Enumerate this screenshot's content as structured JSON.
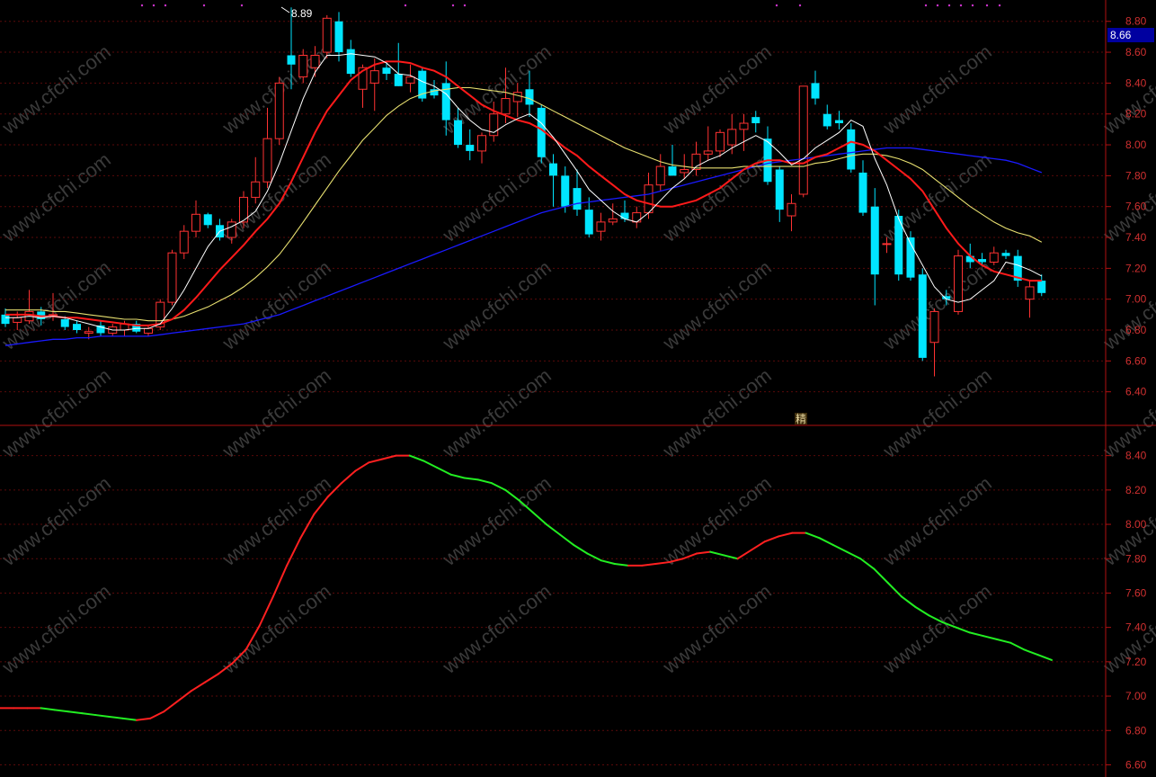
{
  "watermark": "www.cfchi.com",
  "price_tag": "8.66",
  "high_label": "8.89",
  "mid_marker": "精",
  "colors": {
    "background": "#000000",
    "up": "#ff3232",
    "down": "#00e5ff",
    "ma5": "#ffffff",
    "ma10": "#ff1a1a",
    "ma20": "#e8e070",
    "ma60": "#1a1aff",
    "axis": "#b01010",
    "grid": "#5a0a0a",
    "price_tag_bg": "#0000a0",
    "indicator_up": "#ff2020",
    "indicator_down": "#22ee22",
    "signal_dot": "#cc33cc"
  },
  "chart_data": [
    {
      "type": "candlestick",
      "ylim": [
        6.2,
        8.88
      ],
      "y_ticks": [
        "8.80",
        "8.60",
        "8.40",
        "8.20",
        "8.00",
        "7.80",
        "7.60",
        "7.40",
        "7.20",
        "7.00",
        "6.80",
        "6.60",
        "6.40"
      ],
      "grid": true,
      "candles": [
        {
          "o": 6.9,
          "h": 6.94,
          "l": 6.82,
          "c": 6.84
        },
        {
          "o": 6.85,
          "h": 6.92,
          "l": 6.8,
          "c": 6.88
        },
        {
          "o": 6.86,
          "h": 7.06,
          "l": 6.84,
          "c": 6.92
        },
        {
          "o": 6.92,
          "h": 6.95,
          "l": 6.83,
          "c": 6.87
        },
        {
          "o": 6.9,
          "h": 7.04,
          "l": 6.86,
          "c": 6.9
        },
        {
          "o": 6.87,
          "h": 6.89,
          "l": 6.8,
          "c": 6.82
        },
        {
          "o": 6.84,
          "h": 6.86,
          "l": 6.78,
          "c": 6.8
        },
        {
          "o": 6.78,
          "h": 6.82,
          "l": 6.74,
          "c": 6.79
        },
        {
          "o": 6.83,
          "h": 6.86,
          "l": 6.76,
          "c": 6.78
        },
        {
          "o": 6.78,
          "h": 6.84,
          "l": 6.76,
          "c": 6.82
        },
        {
          "o": 6.8,
          "h": 6.86,
          "l": 6.76,
          "c": 6.84
        },
        {
          "o": 6.84,
          "h": 6.86,
          "l": 6.78,
          "c": 6.79
        },
        {
          "o": 6.78,
          "h": 6.83,
          "l": 6.76,
          "c": 6.81
        },
        {
          "o": 6.82,
          "h": 7.0,
          "l": 6.8,
          "c": 6.98
        },
        {
          "o": 6.98,
          "h": 7.32,
          "l": 6.96,
          "c": 7.3
        },
        {
          "o": 7.3,
          "h": 7.48,
          "l": 7.26,
          "c": 7.44
        },
        {
          "o": 7.44,
          "h": 7.64,
          "l": 7.4,
          "c": 7.55
        },
        {
          "o": 7.55,
          "h": 7.56,
          "l": 7.46,
          "c": 7.48
        },
        {
          "o": 7.48,
          "h": 7.52,
          "l": 7.38,
          "c": 7.4
        },
        {
          "o": 7.4,
          "h": 7.52,
          "l": 7.36,
          "c": 7.5
        },
        {
          "o": 7.5,
          "h": 7.7,
          "l": 7.46,
          "c": 7.66
        },
        {
          "o": 7.66,
          "h": 7.92,
          "l": 7.62,
          "c": 7.76
        },
        {
          "o": 7.76,
          "h": 8.24,
          "l": 7.72,
          "c": 8.04
        },
        {
          "o": 8.04,
          "h": 8.44,
          "l": 8.0,
          "c": 8.4
        },
        {
          "o": 8.58,
          "h": 8.89,
          "l": 8.36,
          "c": 8.52
        },
        {
          "o": 8.44,
          "h": 8.62,
          "l": 8.4,
          "c": 8.58
        },
        {
          "o": 8.5,
          "h": 8.64,
          "l": 8.44,
          "c": 8.58
        },
        {
          "o": 8.6,
          "h": 8.84,
          "l": 8.56,
          "c": 8.82
        },
        {
          "o": 8.8,
          "h": 8.86,
          "l": 8.54,
          "c": 8.6
        },
        {
          "o": 8.62,
          "h": 8.68,
          "l": 8.44,
          "c": 8.46
        },
        {
          "o": 8.36,
          "h": 8.52,
          "l": 8.24,
          "c": 8.5
        },
        {
          "o": 8.4,
          "h": 8.56,
          "l": 8.22,
          "c": 8.48
        },
        {
          "o": 8.5,
          "h": 8.54,
          "l": 8.42,
          "c": 8.46
        },
        {
          "o": 8.46,
          "h": 8.66,
          "l": 8.38,
          "c": 8.38
        },
        {
          "o": 8.4,
          "h": 8.52,
          "l": 8.34,
          "c": 8.44
        },
        {
          "o": 8.48,
          "h": 8.5,
          "l": 8.28,
          "c": 8.3
        },
        {
          "o": 8.36,
          "h": 8.42,
          "l": 8.3,
          "c": 8.32
        },
        {
          "o": 8.4,
          "h": 8.54,
          "l": 8.06,
          "c": 8.16
        },
        {
          "o": 8.16,
          "h": 8.24,
          "l": 7.98,
          "c": 8.0
        },
        {
          "o": 8.0,
          "h": 8.1,
          "l": 7.9,
          "c": 7.96
        },
        {
          "o": 7.96,
          "h": 8.08,
          "l": 7.88,
          "c": 8.06
        },
        {
          "o": 8.06,
          "h": 8.28,
          "l": 8.02,
          "c": 8.2
        },
        {
          "o": 8.2,
          "h": 8.5,
          "l": 8.14,
          "c": 8.3
        },
        {
          "o": 8.28,
          "h": 8.4,
          "l": 8.18,
          "c": 8.34
        },
        {
          "o": 8.36,
          "h": 8.48,
          "l": 8.18,
          "c": 8.26
        },
        {
          "o": 8.24,
          "h": 8.26,
          "l": 7.88,
          "c": 7.92
        },
        {
          "o": 7.88,
          "h": 7.94,
          "l": 7.6,
          "c": 7.8
        },
        {
          "o": 7.8,
          "h": 7.86,
          "l": 7.56,
          "c": 7.6
        },
        {
          "o": 7.72,
          "h": 7.84,
          "l": 7.54,
          "c": 7.58
        },
        {
          "o": 7.58,
          "h": 7.66,
          "l": 7.4,
          "c": 7.42
        },
        {
          "o": 7.44,
          "h": 7.56,
          "l": 7.38,
          "c": 7.5
        },
        {
          "o": 7.5,
          "h": 7.62,
          "l": 7.48,
          "c": 7.52
        },
        {
          "o": 7.56,
          "h": 7.64,
          "l": 7.5,
          "c": 7.52
        },
        {
          "o": 7.5,
          "h": 7.6,
          "l": 7.46,
          "c": 7.56
        },
        {
          "o": 7.56,
          "h": 7.82,
          "l": 7.52,
          "c": 7.74
        },
        {
          "o": 7.74,
          "h": 7.94,
          "l": 7.7,
          "c": 7.86
        },
        {
          "o": 7.86,
          "h": 8.0,
          "l": 7.8,
          "c": 7.8
        },
        {
          "o": 7.82,
          "h": 7.94,
          "l": 7.78,
          "c": 7.84
        },
        {
          "o": 7.84,
          "h": 8.02,
          "l": 7.8,
          "c": 7.94
        },
        {
          "o": 7.94,
          "h": 8.12,
          "l": 7.9,
          "c": 7.96
        },
        {
          "o": 7.96,
          "h": 8.1,
          "l": 7.92,
          "c": 8.08
        },
        {
          "o": 8.0,
          "h": 8.2,
          "l": 7.94,
          "c": 8.1
        },
        {
          "o": 8.1,
          "h": 8.2,
          "l": 7.96,
          "c": 8.14
        },
        {
          "o": 8.18,
          "h": 8.22,
          "l": 8.08,
          "c": 8.14
        },
        {
          "o": 8.04,
          "h": 8.12,
          "l": 7.74,
          "c": 7.76
        },
        {
          "o": 7.84,
          "h": 7.86,
          "l": 7.5,
          "c": 7.58
        },
        {
          "o": 7.54,
          "h": 7.68,
          "l": 7.44,
          "c": 7.62
        },
        {
          "o": 7.68,
          "h": 8.38,
          "l": 7.66,
          "c": 8.38
        },
        {
          "o": 8.4,
          "h": 8.48,
          "l": 8.26,
          "c": 8.3
        },
        {
          "o": 8.2,
          "h": 8.26,
          "l": 8.1,
          "c": 8.12
        },
        {
          "o": 8.16,
          "h": 8.22,
          "l": 8.1,
          "c": 8.14
        },
        {
          "o": 8.1,
          "h": 8.14,
          "l": 7.82,
          "c": 7.84
        },
        {
          "o": 7.82,
          "h": 7.9,
          "l": 7.54,
          "c": 7.56
        },
        {
          "o": 7.6,
          "h": 7.72,
          "l": 6.96,
          "c": 7.16
        },
        {
          "o": 7.36,
          "h": 7.4,
          "l": 7.3,
          "c": 7.36
        },
        {
          "o": 7.54,
          "h": 7.58,
          "l": 7.12,
          "c": 7.16
        },
        {
          "o": 7.4,
          "h": 7.44,
          "l": 7.12,
          "c": 7.14
        },
        {
          "o": 7.16,
          "h": 7.2,
          "l": 6.6,
          "c": 6.62
        },
        {
          "o": 6.72,
          "h": 6.94,
          "l": 6.5,
          "c": 6.92
        },
        {
          "o": 7.02,
          "h": 7.06,
          "l": 6.96,
          "c": 7.0
        },
        {
          "o": 6.92,
          "h": 7.32,
          "l": 6.9,
          "c": 7.28
        },
        {
          "o": 7.28,
          "h": 7.36,
          "l": 7.2,
          "c": 7.24
        },
        {
          "o": 7.26,
          "h": 7.3,
          "l": 7.22,
          "c": 7.24
        },
        {
          "o": 7.24,
          "h": 7.34,
          "l": 7.22,
          "c": 7.3
        },
        {
          "o": 7.3,
          "h": 7.32,
          "l": 7.26,
          "c": 7.28
        },
        {
          "o": 7.28,
          "h": 7.32,
          "l": 7.08,
          "c": 7.12
        },
        {
          "o": 7.0,
          "h": 7.12,
          "l": 6.88,
          "c": 7.08
        },
        {
          "o": 7.12,
          "h": 7.16,
          "l": 7.02,
          "c": 7.04
        }
      ],
      "ma5": [
        6.88,
        6.88,
        6.89,
        6.88,
        6.89,
        6.88,
        6.86,
        6.84,
        6.82,
        6.8,
        6.8,
        6.81,
        6.81,
        6.84,
        6.94,
        7.06,
        7.2,
        7.34,
        7.44,
        7.47,
        7.51,
        7.57,
        7.7,
        7.88,
        8.09,
        8.3,
        8.47,
        8.58,
        8.58,
        8.59,
        8.58,
        8.57,
        8.53,
        8.46,
        8.45,
        8.41,
        8.38,
        8.33,
        8.24,
        8.16,
        8.1,
        8.08,
        8.13,
        8.17,
        8.2,
        8.14,
        8.05,
        7.94,
        7.83,
        7.71,
        7.64,
        7.57,
        7.52,
        7.5,
        7.56,
        7.64,
        7.72,
        7.78,
        7.86,
        7.9,
        7.93,
        7.98,
        8.02,
        8.06,
        8.02,
        7.95,
        7.87,
        7.91,
        7.98,
        8.03,
        8.08,
        8.16,
        8.12,
        7.91,
        7.74,
        7.52,
        7.36,
        7.22,
        7.08,
        7.0,
        6.98,
        7.0,
        7.06,
        7.12,
        7.24,
        7.22,
        7.19,
        7.15
      ],
      "ma10": [
        6.9,
        6.9,
        6.9,
        6.89,
        6.89,
        6.88,
        6.88,
        6.87,
        6.86,
        6.85,
        6.84,
        6.83,
        6.83,
        6.84,
        6.87,
        6.93,
        7.01,
        7.1,
        7.19,
        7.27,
        7.35,
        7.44,
        7.52,
        7.62,
        7.76,
        7.92,
        8.08,
        8.22,
        8.32,
        8.42,
        8.48,
        8.52,
        8.54,
        8.54,
        8.53,
        8.5,
        8.48,
        8.44,
        8.38,
        8.32,
        8.26,
        8.22,
        8.19,
        8.16,
        8.14,
        8.1,
        8.04,
        7.98,
        7.93,
        7.86,
        7.8,
        7.74,
        7.68,
        7.64,
        7.62,
        7.6,
        7.6,
        7.62,
        7.64,
        7.68,
        7.72,
        7.78,
        7.84,
        7.88,
        7.9,
        7.9,
        7.88,
        7.88,
        7.92,
        7.94,
        7.98,
        8.02,
        8.0,
        7.96,
        7.9,
        7.84,
        7.78,
        7.7,
        7.58,
        7.46,
        7.36,
        7.28,
        7.22,
        7.18,
        7.16,
        7.14,
        7.12,
        7.12
      ],
      "ma20": [
        6.93,
        6.93,
        6.93,
        6.93,
        6.92,
        6.92,
        6.91,
        6.9,
        6.89,
        6.88,
        6.87,
        6.87,
        6.86,
        6.86,
        6.87,
        6.89,
        6.92,
        6.95,
        6.99,
        7.03,
        7.08,
        7.14,
        7.21,
        7.29,
        7.39,
        7.5,
        7.61,
        7.72,
        7.83,
        7.93,
        8.03,
        8.11,
        8.19,
        8.25,
        8.3,
        8.33,
        8.35,
        8.36,
        8.37,
        8.37,
        8.36,
        8.35,
        8.34,
        8.32,
        8.3,
        8.26,
        8.22,
        8.18,
        8.14,
        8.1,
        8.06,
        8.02,
        7.98,
        7.95,
        7.92,
        7.89,
        7.87,
        7.86,
        7.85,
        7.85,
        7.85,
        7.85,
        7.86,
        7.86,
        7.86,
        7.86,
        7.86,
        7.86,
        7.88,
        7.89,
        7.91,
        7.93,
        7.94,
        7.94,
        7.93,
        7.91,
        7.88,
        7.84,
        7.78,
        7.72,
        7.66,
        7.6,
        7.55,
        7.5,
        7.46,
        7.43,
        7.41,
        7.37
      ],
      "ma60": [
        6.7,
        6.71,
        6.72,
        6.73,
        6.74,
        6.74,
        6.75,
        6.75,
        6.76,
        6.76,
        6.76,
        6.76,
        6.76,
        6.77,
        6.78,
        6.79,
        6.8,
        6.81,
        6.82,
        6.83,
        6.84,
        6.86,
        6.88,
        6.9,
        6.93,
        6.96,
        6.99,
        7.02,
        7.05,
        7.08,
        7.11,
        7.14,
        7.17,
        7.2,
        7.23,
        7.26,
        7.29,
        7.32,
        7.35,
        7.38,
        7.41,
        7.44,
        7.47,
        7.5,
        7.53,
        7.56,
        7.58,
        7.6,
        7.62,
        7.63,
        7.64,
        7.65,
        7.66,
        7.67,
        7.68,
        7.7,
        7.72,
        7.74,
        7.76,
        7.78,
        7.8,
        7.82,
        7.84,
        7.86,
        7.88,
        7.89,
        7.9,
        7.91,
        7.92,
        7.93,
        7.94,
        7.95,
        7.96,
        7.97,
        7.98,
        7.98,
        7.98,
        7.97,
        7.96,
        7.95,
        7.94,
        7.93,
        7.92,
        7.91,
        7.9,
        7.88,
        7.85,
        7.82
      ]
    },
    {
      "type": "line",
      "ylim": [
        6.55,
        8.55
      ],
      "y_ticks": [
        "8.40",
        "8.20",
        "8.00",
        "7.80",
        "7.60",
        "7.40",
        "7.20",
        "7.00",
        "6.80",
        "6.60"
      ],
      "grid": true,
      "values": [
        6.93,
        6.93,
        6.93,
        6.93,
        6.92,
        6.91,
        6.9,
        6.89,
        6.88,
        6.87,
        6.86,
        6.87,
        6.91,
        6.97,
        7.03,
        7.08,
        7.13,
        7.19,
        7.27,
        7.41,
        7.58,
        7.76,
        7.92,
        8.06,
        8.16,
        8.24,
        8.31,
        8.36,
        8.38,
        8.4,
        8.4,
        8.37,
        8.33,
        8.29,
        8.27,
        8.26,
        8.24,
        8.2,
        8.14,
        8.07,
        8.0,
        7.94,
        7.88,
        7.83,
        7.79,
        7.77,
        7.76,
        7.76,
        7.77,
        7.78,
        7.8,
        7.83,
        7.84,
        7.82,
        7.8,
        7.85,
        7.9,
        7.93,
        7.95,
        7.95,
        7.92,
        7.88,
        7.84,
        7.8,
        7.74,
        7.66,
        7.58,
        7.52,
        7.47,
        7.43,
        7.4,
        7.37,
        7.35,
        7.33,
        7.31,
        7.27,
        7.24,
        7.21
      ]
    }
  ]
}
